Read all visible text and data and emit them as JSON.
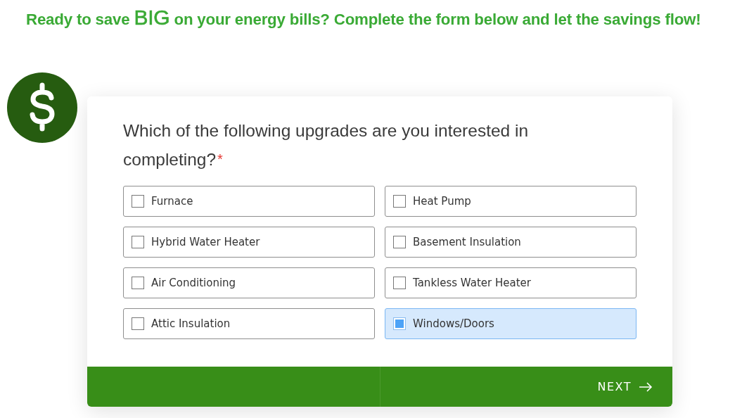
{
  "headline": {
    "before": "Ready to save",
    "emphasis": "BIG",
    "after": "on your energy bills? Complete the form below and let the savings flow!"
  },
  "question": {
    "text": "Which of the following upgrades are you interested in completing?",
    "required_mark": "*"
  },
  "options": [
    {
      "label": "Furnace",
      "checked": false
    },
    {
      "label": "Heat Pump",
      "checked": false
    },
    {
      "label": "Hybrid Water Heater",
      "checked": false
    },
    {
      "label": "Basement Insulation",
      "checked": false
    },
    {
      "label": "Air Conditioning",
      "checked": false
    },
    {
      "label": "Tankless Water Heater",
      "checked": false
    },
    {
      "label": "Attic Insulation",
      "checked": false
    },
    {
      "label": "Windows/Doors",
      "checked": true
    }
  ],
  "next_button": {
    "label": "NEXT"
  }
}
